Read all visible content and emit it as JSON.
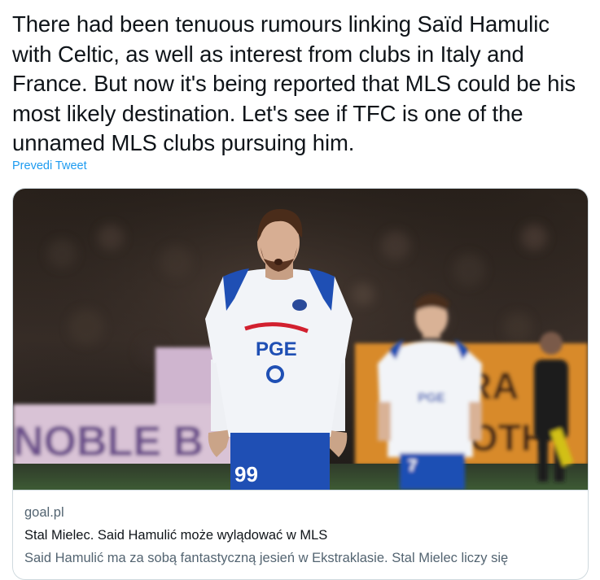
{
  "tweet": {
    "text": "There had been tenuous rumours linking Saïd Hamulic with Celtic, as well as interest from clubs in Italy and France. But now it's being reported that MLS could be his most likely destination. Let's see if TFC is one of the unnamed MLS clubs pursuing him.",
    "translate_label": "Prevedi Tweet"
  },
  "card": {
    "domain": "goal.pl",
    "title": "Stal Mielec. Said Hamulić może wylądować w MLS",
    "description": "Said Hamulić ma za sobą fantastyczną jesień w Ekstraklasie. Stal Mielec liczy się",
    "image": {
      "banner_left_text": "NOBLE B",
      "banner_right_text_1": "RA",
      "banner_right_text_2": "OTH",
      "sponsor_text": "PGE",
      "player_number": "99",
      "player2_number": "7"
    }
  },
  "colors": {
    "link": "#1d9bf0",
    "text_primary": "#0f1419",
    "text_secondary": "#536471",
    "border": "#cfd9de",
    "kit_white": "#f2f4f8",
    "kit_blue": "#1f4fb4"
  }
}
